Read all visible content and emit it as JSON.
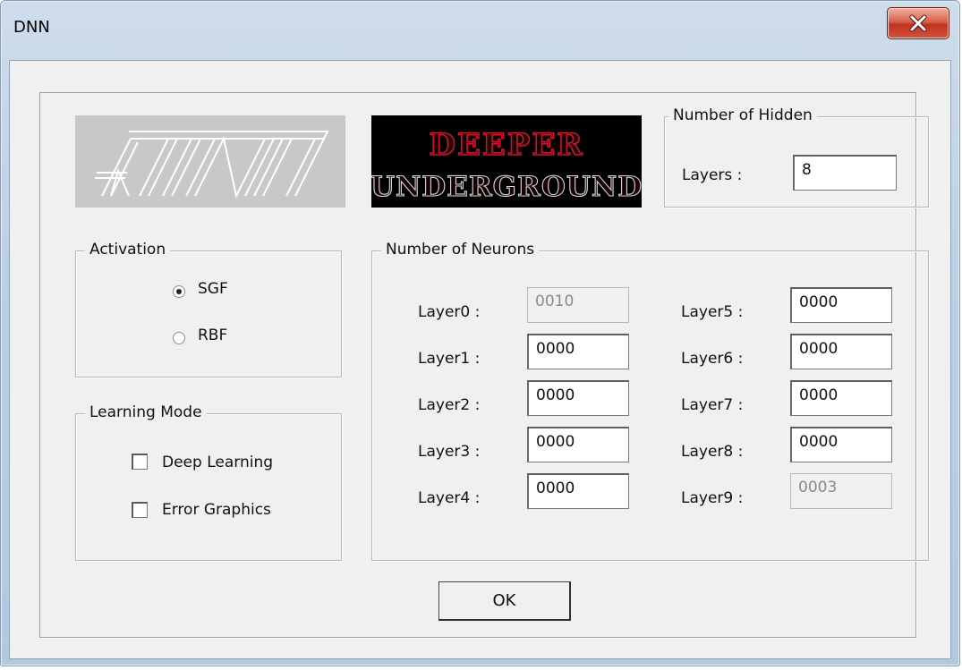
{
  "window": {
    "title": "DNN"
  },
  "logos": {
    "atint_text": "ATINT",
    "deeper_line1": "DEEPER",
    "deeper_line2": "UNDERGROUND"
  },
  "hidden": {
    "group_title": "Number of Hidden",
    "layers_label": "Layers :",
    "layers_value": "8"
  },
  "activation": {
    "group_title": "Activation",
    "options": [
      {
        "label": "SGF",
        "selected": true
      },
      {
        "label": "RBF",
        "selected": false
      }
    ]
  },
  "learning": {
    "group_title": "Learning Mode",
    "options": [
      {
        "label": "Deep Learning",
        "checked": false
      },
      {
        "label": "Error Graphics",
        "checked": false
      }
    ]
  },
  "neurons": {
    "group_title": "Number of Neurons",
    "layers": [
      {
        "label": "Layer0 :",
        "value": "0010",
        "enabled": false
      },
      {
        "label": "Layer1 :",
        "value": "0000",
        "enabled": true
      },
      {
        "label": "Layer2 :",
        "value": "0000",
        "enabled": true
      },
      {
        "label": "Layer3 :",
        "value": "0000",
        "enabled": true
      },
      {
        "label": "Layer4 :",
        "value": "0000",
        "enabled": true
      },
      {
        "label": "Layer5 :",
        "value": "0000",
        "enabled": true
      },
      {
        "label": "Layer6 :",
        "value": "0000",
        "enabled": true
      },
      {
        "label": "Layer7 :",
        "value": "0000",
        "enabled": true
      },
      {
        "label": "Layer8 :",
        "value": "0000",
        "enabled": true
      },
      {
        "label": "Layer9 :",
        "value": "0003",
        "enabled": false
      }
    ]
  },
  "ok_label": "OK",
  "icons": {
    "close": "close-icon",
    "radio_selected": "radio-selected-icon"
  },
  "colors": {
    "close_red": "#c8432c",
    "deeper_red": "#c8102e"
  }
}
